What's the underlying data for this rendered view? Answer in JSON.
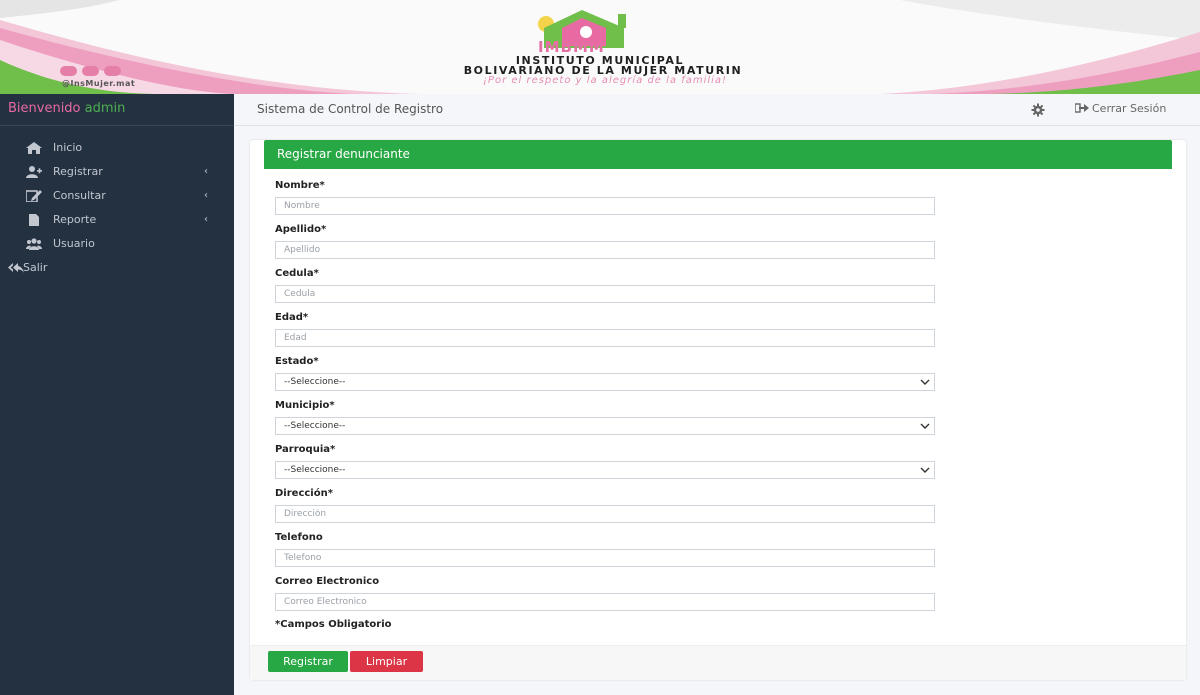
{
  "banner": {
    "logo_text": "IMBMM",
    "institution_line1": "INSTITUTO MUNICIPAL",
    "institution_line2": "BOLIVARIANO DE LA MUJER MATURIN",
    "slogan": "¡Por el respeto y la alegría de la familia!",
    "social_handle": "@InsMujer.mat",
    "colors": {
      "pink": "#e86aa3",
      "green": "#4caf50"
    }
  },
  "sidebar": {
    "welcome": "Bienvenido",
    "user": "admin",
    "items": [
      {
        "label": "Inicio",
        "icon": "home-icon"
      },
      {
        "label": "Registrar",
        "icon": "user-plus-icon"
      },
      {
        "label": "Consultar",
        "icon": "edit-icon"
      },
      {
        "label": "Reporte",
        "icon": "file-icon"
      },
      {
        "label": "Usuario",
        "icon": "users-icon"
      },
      {
        "label": "Salir",
        "icon": "reply-all-icon"
      }
    ],
    "chevron": "‹"
  },
  "topbar": {
    "title": "Sistema de Control de Registro",
    "logout": "Cerrar Sesión"
  },
  "form": {
    "header": "Registrar denunciante",
    "fields": {
      "nombre": {
        "label": "Nombre*",
        "placeholder": "Nombre"
      },
      "apellido": {
        "label": "Apellido*",
        "placeholder": "Apellido"
      },
      "cedula": {
        "label": "Cedula*",
        "placeholder": "Cedula"
      },
      "edad": {
        "label": "Edad*",
        "placeholder": "Edad"
      },
      "estado": {
        "label": "Estado*",
        "value": "--Seleccione--"
      },
      "municipio": {
        "label": "Municipio*",
        "value": "--Seleccione--"
      },
      "parroquia": {
        "label": "Parroquia*",
        "value": "--Seleccione--"
      },
      "direccion": {
        "label": "Dirección*",
        "placeholder": "Dirección"
      },
      "telefono": {
        "label": "Telefono",
        "placeholder": "Telefono"
      },
      "correo": {
        "label": "Correo Electronico",
        "placeholder": "Correo Electronico"
      }
    },
    "required_note": "*Campos Obligatorio",
    "buttons": {
      "register": "Registrar",
      "clear": "Limpiar"
    },
    "colors": {
      "header": "#28a745",
      "register": "#28a745",
      "clear": "#dc3545"
    }
  }
}
